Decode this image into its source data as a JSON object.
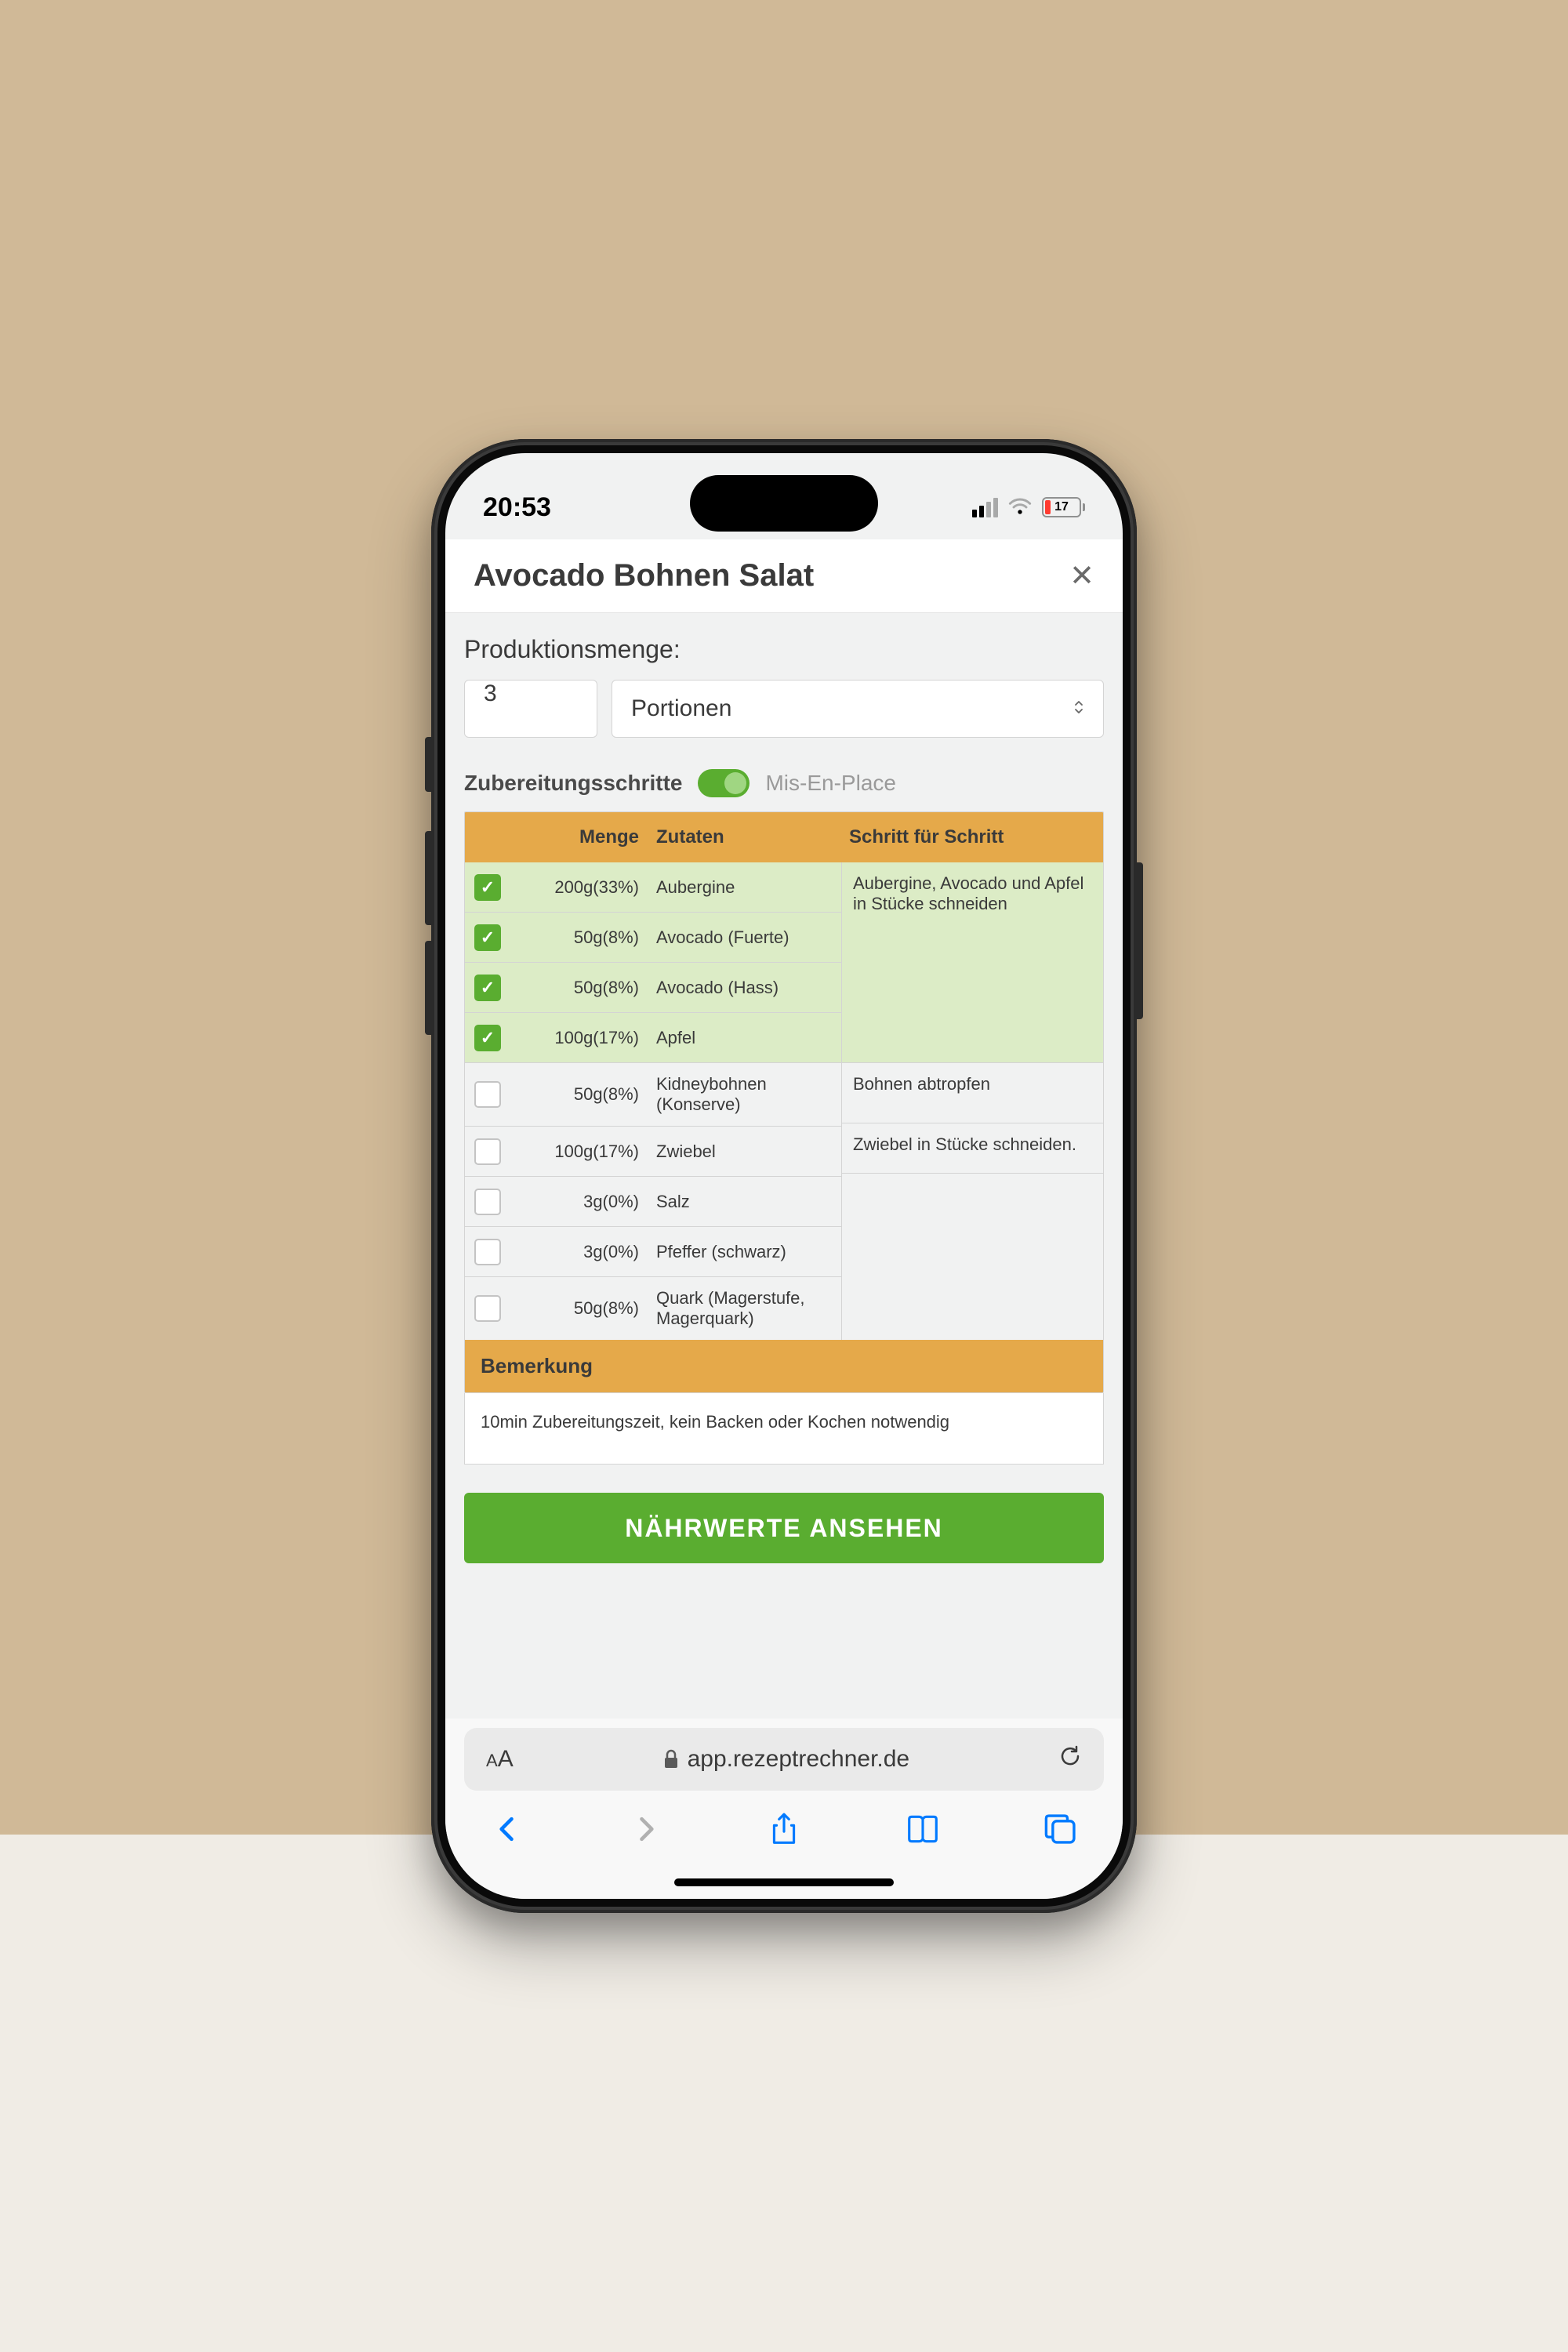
{
  "status": {
    "time": "20:53",
    "battery_percent": "17"
  },
  "header": {
    "title": "Avocado Bohnen Salat"
  },
  "production": {
    "label": "Produktionsmenge:",
    "quantity": "3",
    "unit": "Portionen"
  },
  "steps": {
    "label": "Zubereitungsschritte",
    "toggle_label": "Mis-En-Place"
  },
  "table": {
    "col_menge": "Menge",
    "col_zutaten": "Zutaten",
    "col_schritt": "Schritt für Schritt",
    "ingredients": [
      {
        "checked": true,
        "amount": "200g(33%)",
        "name": "Aubergine"
      },
      {
        "checked": true,
        "amount": "50g(8%)",
        "name": "Avocado (Fuerte)"
      },
      {
        "checked": true,
        "amount": "50g(8%)",
        "name": "Avocado (Hass)"
      },
      {
        "checked": true,
        "amount": "100g(17%)",
        "name": "Apfel"
      },
      {
        "checked": false,
        "amount": "50g(8%)",
        "name": "Kidneybohnen (Konserve)"
      },
      {
        "checked": false,
        "amount": "100g(17%)",
        "name": "Zwiebel"
      },
      {
        "checked": false,
        "amount": "3g(0%)",
        "name": "Salz"
      },
      {
        "checked": false,
        "amount": "3g(0%)",
        "name": "Pfeffer (schwarz)"
      },
      {
        "checked": false,
        "amount": "50g(8%)",
        "name": "Quark (Magerstufe, Magerquark)"
      }
    ],
    "step1": "Aubergine, Avocado und Apfel in Stücke schneiden",
    "step2": "Bohnen abtropfen",
    "step3": "Zwiebel in Stücke schneiden."
  },
  "remark": {
    "header": "Bemerkung",
    "text": "10min Zubereitungszeit, kein Backen oder Kochen notwendig"
  },
  "button": {
    "nutrition": "NÄHRWERTE ANSEHEN"
  },
  "safari": {
    "aa": "AA",
    "url": "app.rezeptrechner.de"
  }
}
